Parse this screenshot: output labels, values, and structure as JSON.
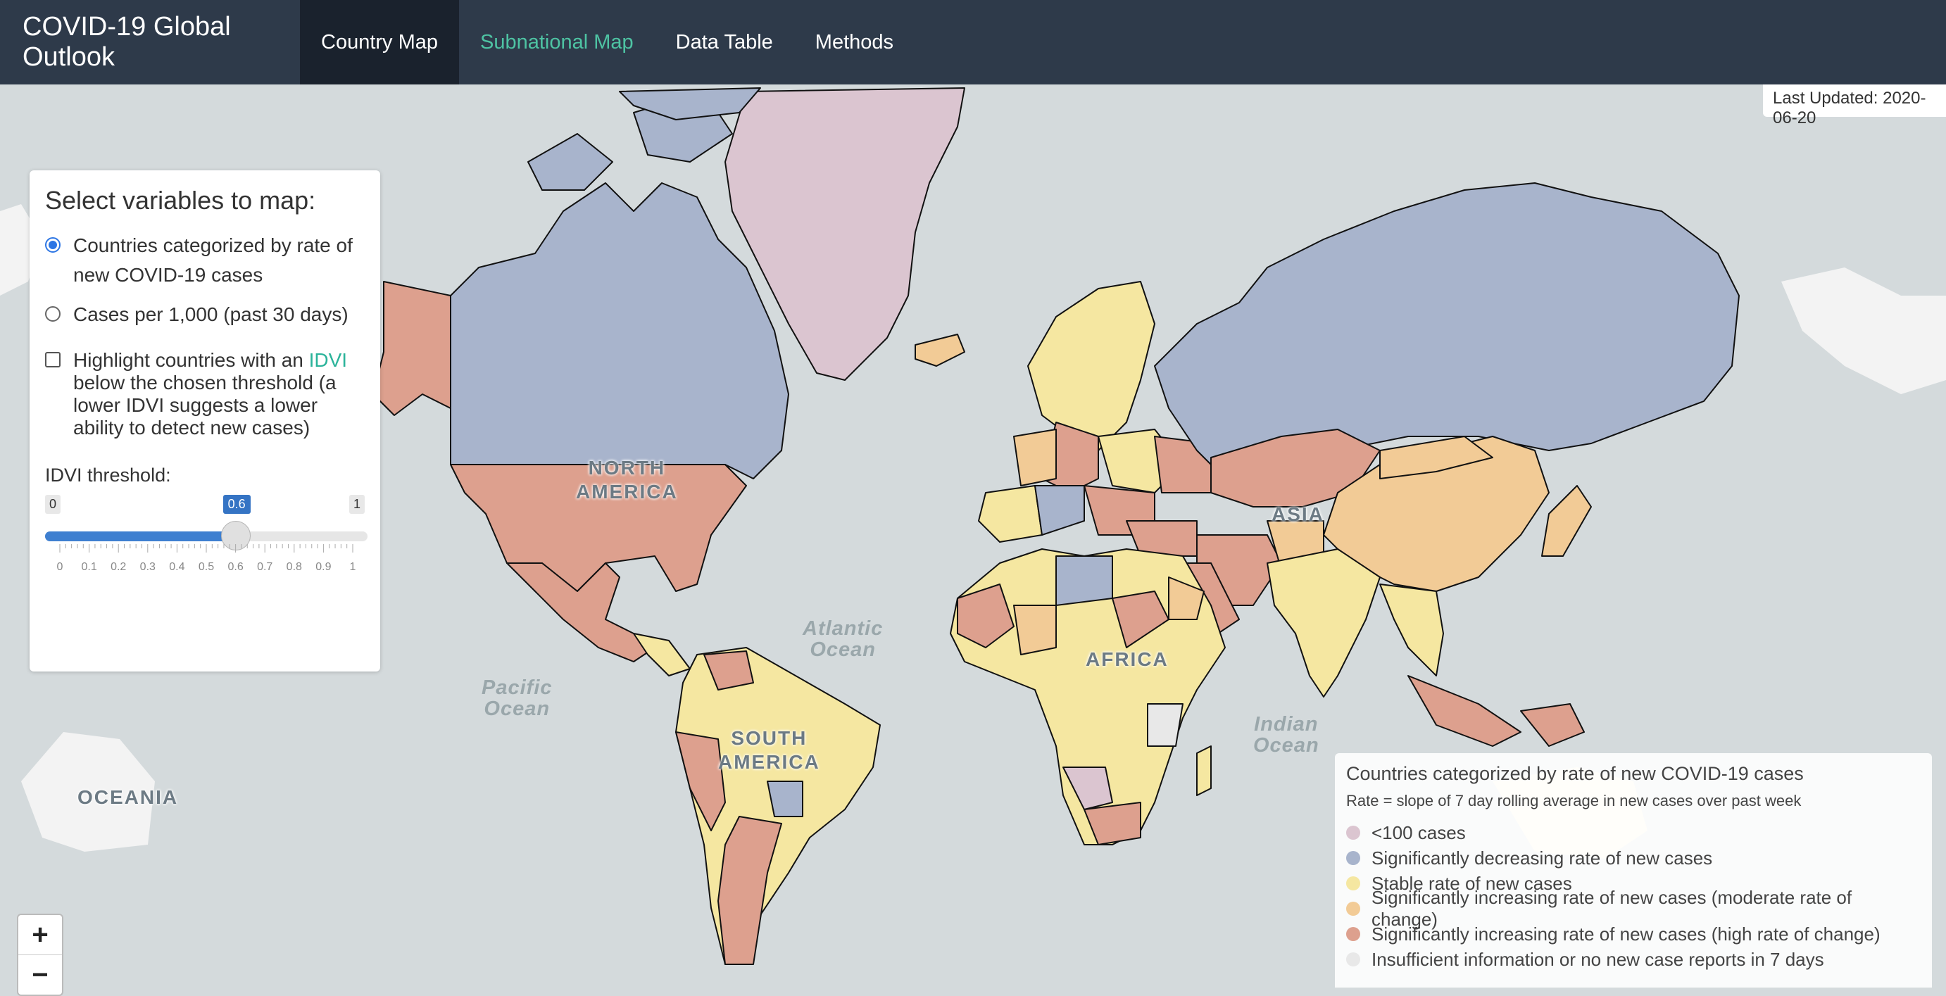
{
  "navbar": {
    "brand": "COVID-19 Global Outlook",
    "tabs": [
      {
        "label": "Country Map",
        "active": true
      },
      {
        "label": "Subnational Map",
        "active": false
      },
      {
        "label": "Data Table",
        "active": false
      },
      {
        "label": "Methods",
        "active": false
      }
    ]
  },
  "map": {
    "last_updated": "Last Updated: 2020-06-20",
    "oceans": {
      "atlantic": "Atlantic\nOcean",
      "pacific": "Pacific\nOcean",
      "indian": "Indian\nOcean"
    },
    "continents": {
      "north_america": "NORTH\nAMERICA",
      "south_america": "SOUTH\nAMERICA",
      "africa": "AFRICA",
      "asia": "ASIA",
      "oceania": "OCEANIA"
    }
  },
  "panel": {
    "title": "Select variables to map:",
    "radio_options": [
      {
        "label": "Countries categorized by rate of new COVID-19 cases",
        "checked": true
      },
      {
        "label": "Cases per 1,000 (past 30 days)",
        "checked": false
      }
    ],
    "checkbox": {
      "prefix": "Highlight countries with an ",
      "link": "IDVI",
      "suffix": " below the chosen threshold (a lower IDVI suggests a lower ability to detect new cases)",
      "checked": false
    },
    "slider": {
      "label": "IDVI threshold:",
      "min": "0",
      "max": "1",
      "value": "0.6",
      "value_num": 0.6,
      "ticks": [
        "0",
        "0.1",
        "0.2",
        "0.3",
        "0.4",
        "0.5",
        "0.6",
        "0.7",
        "0.8",
        "0.9",
        "1"
      ]
    }
  },
  "zoom": {
    "plus": "+",
    "minus": "−"
  },
  "legend": {
    "title": "Countries categorized by rate of new COVID-19 cases",
    "subtitle": "Rate = slope of 7 day rolling average in new cases over past week",
    "items": [
      {
        "label": "<100 cases",
        "color": "#dbc5d0"
      },
      {
        "label": "Significantly decreasing rate of new cases",
        "color": "#a8b4cc"
      },
      {
        "label": "Stable rate of new cases",
        "color": "#f5e7a1"
      },
      {
        "label": "Significantly increasing rate of new cases (moderate rate of change)",
        "color": "#f2cb96"
      },
      {
        "label": "Significantly increasing rate of new cases (high rate of change)",
        "color": "#dda08e"
      },
      {
        "label": "Insufficient information or no new case reports in 7 days",
        "color": "#e8e8e8"
      }
    ]
  }
}
